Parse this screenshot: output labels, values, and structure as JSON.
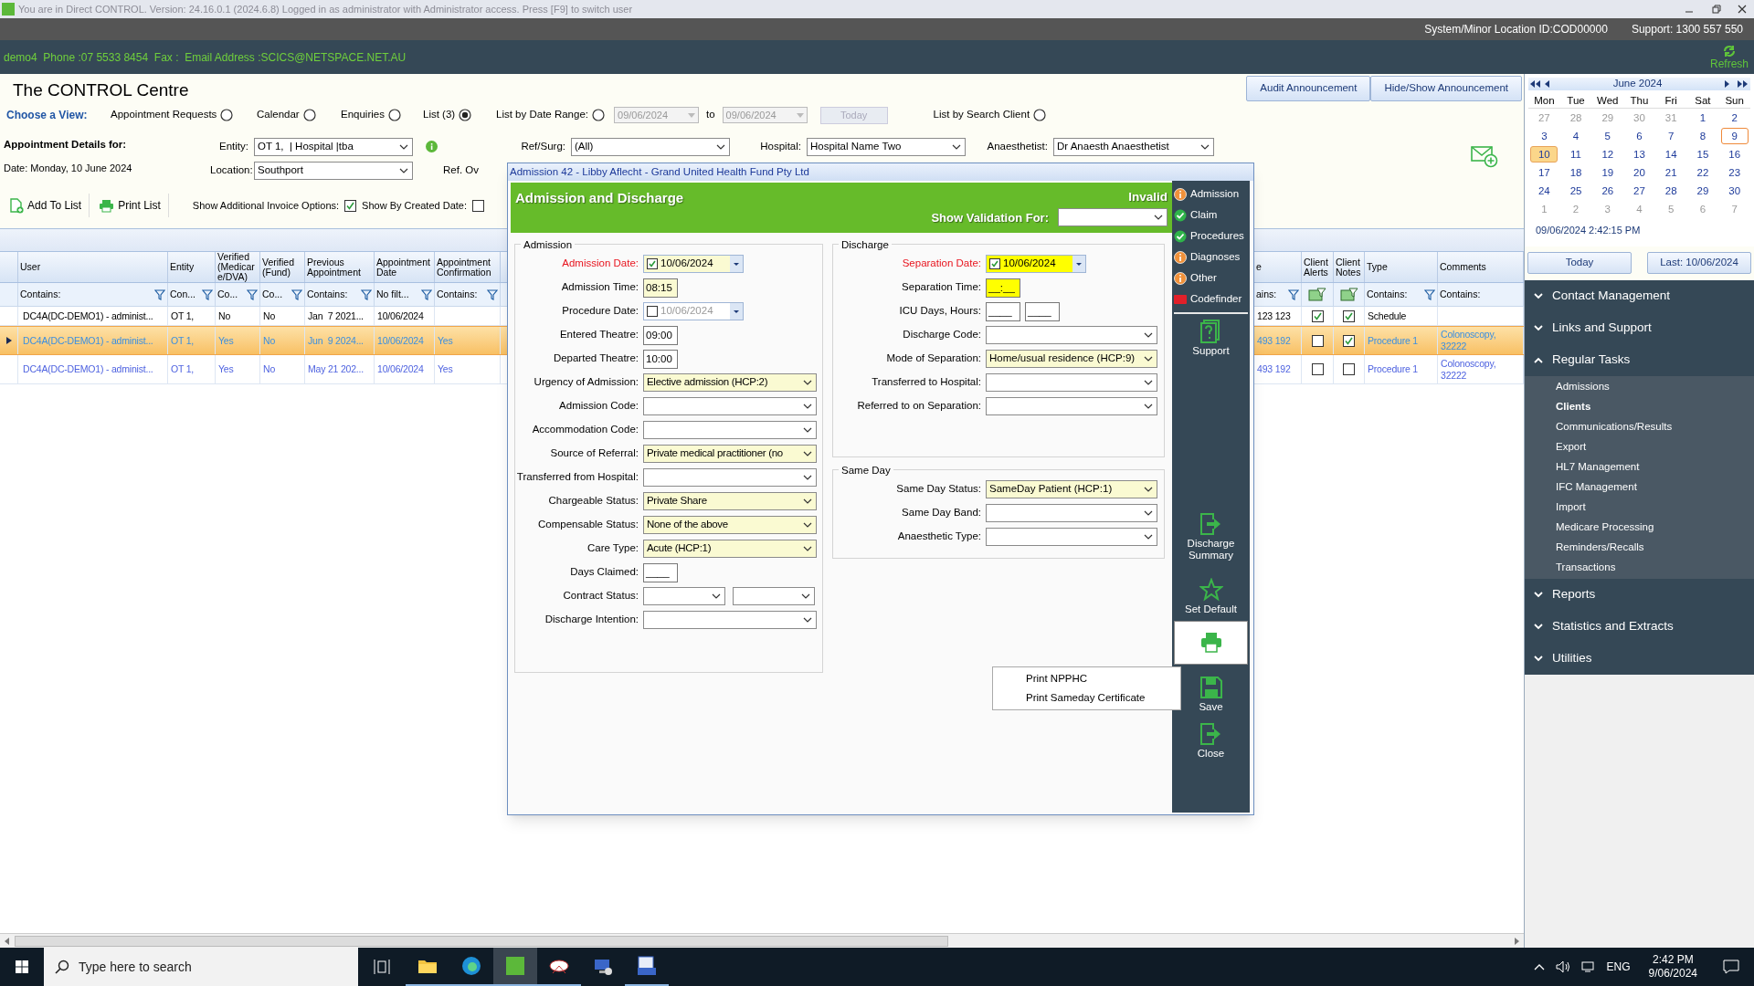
{
  "title_bar": {
    "text": "You are in Direct CONTROL. Version: 24.16.0.1 (2024.6.8) Logged in as administrator with Administrator access. Press [F9] to switch user"
  },
  "info_bar": {
    "location": "System/Minor Location ID:COD00000",
    "support": "Support: 1300 557 550"
  },
  "contact_bar": {
    "contact": "demo4  Phone :07 5533 8454  Fax :  Email Address :SCICS@NETSPACE.NET.AU",
    "refresh": "Refresh"
  },
  "page_title": "The CONTROL Centre",
  "announcement_buttons": [
    "Audit Announcement",
    "Hide/Show Announcement"
  ],
  "view_label": "Choose a View:",
  "views": [
    {
      "label": "Appointment Requests",
      "selected": false,
      "kind": "plain"
    },
    {
      "label": "Calendar",
      "selected": false,
      "kind": "plain"
    },
    {
      "label": "Enquiries",
      "selected": false,
      "kind": "plain"
    },
    {
      "label": "List (3)",
      "selected": true,
      "kind": "plain"
    },
    {
      "label": "List by Date Range:",
      "selected": false,
      "kind": "range",
      "from": "09/06/2024",
      "to_label": "to",
      "to": "09/06/2024",
      "button": "Today"
    },
    {
      "label": "List by Search Client",
      "selected": false,
      "kind": "plain"
    }
  ],
  "details": {
    "heading": "Appointment Details for:",
    "date": "Date: Monday, 10 June 2024"
  },
  "filter_rows": [
    [
      {
        "label": "Entity:",
        "value": "OT 1,  | Hospital |tba"
      },
      {
        "label": "Ref/Surg:",
        "value": "(All)"
      },
      {
        "label": "Hospital:",
        "value": "Hospital Name Two"
      },
      {
        "label": "Anaesthetist:",
        "value": "Dr Anaesth Anaesthetist"
      }
    ],
    [
      {
        "label": "Location:",
        "value": "Southport"
      },
      {
        "label": "Ref. Ov"
      }
    ]
  ],
  "toolbar": [
    {
      "label": "Add To List",
      "kind": "add"
    },
    {
      "label": "Print List",
      "kind": "print"
    }
  ],
  "options": [
    {
      "label": "Show Additional Invoice Options:",
      "checked": true
    },
    {
      "label": "Show By Created Date:",
      "checked": false
    }
  ],
  "table": {
    "columns": [
      {
        "label": "User",
        "filter": "Contains:",
        "funnel": true
      },
      {
        "label": "Entity",
        "filter": "Con...",
        "funnel": true
      },
      {
        "label": "Verified (Medicare/DVA)",
        "filter": "Co...",
        "funnel": true
      },
      {
        "label": "Verified (Fund)",
        "filter": "Co...",
        "funnel": true
      },
      {
        "label": "Previous Appointment",
        "filter": "Contains:",
        "funnel": true
      },
      {
        "label": "Appointment Date",
        "filter": "No filt...",
        "funnel": true
      },
      {
        "label": "Appointment Confirmation",
        "filter": "Contains:",
        "funnel": true
      },
      {
        "label": "e",
        "filter": "ains:",
        "funnel": true
      },
      {
        "label": "Client Alerts",
        "funnel": false
      },
      {
        "label": "Client Notes",
        "funnel": false
      },
      {
        "label": "Type",
        "filter": "Contains:",
        "funnel": true
      },
      {
        "label": "Comments",
        "filter": "Contains:",
        "funnel": false
      }
    ],
    "rows": [
      {
        "selected": false,
        "color": "#000000",
        "cells": [
          "DC4A(DC-DEMO1) - administ...",
          "OT 1,",
          "No",
          "No",
          "Jan  7 2021...",
          "10/06/2024",
          null,
          "123 123",
          {
            "checked": true
          },
          {
            "checked": true
          },
          "Schedule",
          null
        ]
      },
      {
        "selected": true,
        "color": "#3b8fe0",
        "cells": [
          "DC4A(DC-DEMO1) - administ...",
          "OT 1,",
          "Yes",
          "No",
          "Jun  9 2024...",
          "10/06/2024",
          "Yes",
          "493 192",
          {
            "checked": false
          },
          {
            "checked": true
          },
          "Procedure 1",
          "Colonoscopy, 32222"
        ]
      },
      {
        "selected": false,
        "color": "#4f63e0",
        "cells": [
          "DC4A(DC-DEMO1) - administ...",
          "OT 1,",
          "Yes",
          "No",
          "May 21 202...",
          "10/06/2024",
          "Yes",
          "493 192",
          {
            "checked": false
          },
          {
            "checked": false
          },
          "Procedure 1",
          "Colonoscopy, 32222"
        ]
      }
    ]
  },
  "dialog": {
    "title": "Admission 42 - Libby Aflecht - Grand United Health Fund Pty Ltd",
    "heading": "Admission and Discharge",
    "status": "Invalid",
    "validation_label": "Show Validation For:",
    "groups": [
      {
        "title": "Admission",
        "fields": [
          {
            "label": "Admission Date:",
            "kind": "date",
            "checked": true,
            "value": "10/06/2024",
            "required": true,
            "highlighted": true,
            "missing": false
          },
          {
            "label": "Admission Time:",
            "kind": "time",
            "value": "08:15",
            "required": false,
            "highlighted": true,
            "missing": false
          },
          {
            "label": "Procedure Date:",
            "kind": "date",
            "checked": false,
            "value": "10/06/2024",
            "required": false,
            "highlighted": false,
            "missing": false
          },
          {
            "label": "Entered Theatre:",
            "kind": "time",
            "value": "09:00",
            "required": false,
            "highlighted": false,
            "missing": false
          },
          {
            "label": "Departed Theatre:",
            "kind": "time",
            "value": "10:00",
            "required": false,
            "highlighted": false,
            "missing": false
          },
          {
            "label": "Urgency of Admission:",
            "kind": "select",
            "value": "Elective admission (HCP:2)",
            "required": false,
            "highlighted": true,
            "missing": false
          },
          {
            "label": "Admission Code:",
            "kind": "select",
            "required": false,
            "highlighted": false,
            "missing": false
          },
          {
            "label": "Accommodation Code:",
            "kind": "select",
            "required": false,
            "highlighted": false,
            "missing": false
          },
          {
            "label": "Source of Referral:",
            "kind": "select",
            "value": "Private medical practitioner (no",
            "required": false,
            "highlighted": true,
            "missing": false
          },
          {
            "label": "Transferred from Hospital:",
            "kind": "select",
            "required": false,
            "highlighted": false,
            "missing": false
          },
          {
            "label": "Chargeable Status:",
            "kind": "select",
            "value": "Private Share",
            "required": false,
            "highlighted": true,
            "missing": false
          },
          {
            "label": "Compensable Status:",
            "kind": "select",
            "value": "None of the above",
            "required": false,
            "highlighted": true,
            "missing": false
          },
          {
            "label": "Care Type:",
            "kind": "select",
            "value": "Acute (HCP:1)",
            "required": false,
            "highlighted": true,
            "missing": false
          },
          {
            "label": "Days Claimed:",
            "kind": "time",
            "value": "____",
            "required": false,
            "highlighted": false,
            "missing": false
          },
          {
            "label": "Contract Status:",
            "kind": "select_pair",
            "required": false,
            "highlighted": false,
            "missing": false
          },
          {
            "label": "Discharge Intention:",
            "kind": "select",
            "required": false,
            "highlighted": false,
            "missing": false
          }
        ]
      },
      {
        "title": "Discharge",
        "fields": [
          {
            "label": "Separation Date:",
            "kind": "date",
            "checked": true,
            "value": "10/06/2024",
            "required": true,
            "missing": true
          },
          {
            "label": "Separation Time:",
            "kind": "time",
            "value": "__:__",
            "required": false,
            "missing": true
          },
          {
            "label": "ICU Days, Hours:",
            "kind": "time_pair",
            "values": [
              "____",
              "____"
            ],
            "required": false,
            "highlighted": false,
            "missing": false
          },
          {
            "label": "Discharge Code:",
            "kind": "select",
            "required": false,
            "highlighted": false,
            "missing": false
          },
          {
            "label": "Mode of Separation:",
            "kind": "select",
            "value": "Home/usual residence (HCP:9)",
            "required": false,
            "highlighted": true,
            "missing": false
          },
          {
            "label": "Transferred to Hospital:",
            "kind": "select",
            "required": false,
            "highlighted": false,
            "missing": false
          },
          {
            "label": "Referred to on Separation:",
            "kind": "select",
            "required": false,
            "highlighted": false,
            "missing": false
          }
        ]
      },
      {
        "title": "Same Day",
        "fields": [
          {
            "label": "Same Day Status:",
            "kind": "select",
            "value": "SameDay Patient (HCP:1)",
            "required": false,
            "highlighted": true,
            "missing": false
          },
          {
            "label": "Same Day Band:",
            "kind": "select",
            "required": false,
            "highlighted": false,
            "missing": false
          },
          {
            "label": "Anaesthetic Type:",
            "kind": "select",
            "required": false,
            "highlighted": false,
            "missing": false
          }
        ]
      }
    ],
    "validation": [
      {
        "label": "Admission",
        "kind": "warning"
      },
      {
        "label": "Claim",
        "kind": "ok"
      },
      {
        "label": "Procedures",
        "kind": "ok"
      },
      {
        "label": "Diagnoses",
        "kind": "warning"
      },
      {
        "label": "Other",
        "kind": "warning"
      },
      {
        "label": "Codefinder",
        "kind": "logo"
      }
    ],
    "actions": [
      {
        "label": "Support",
        "kind": "help"
      },
      {
        "label": "Discharge Summary",
        "kind": "export"
      },
      {
        "label": "Set Default",
        "kind": "star"
      },
      {
        "kind": "print"
      },
      {
        "label": "Save",
        "kind": "save"
      },
      {
        "label": "Close",
        "kind": "close"
      }
    ],
    "print_menu": [
      "Print NPPHC",
      "Print Sameday Certificate"
    ]
  },
  "calendar": {
    "title": "June 2024",
    "weekdays": [
      "Mon",
      "Tue",
      "Wed",
      "Thu",
      "Fri",
      "Sat",
      "Sun"
    ],
    "days": [
      {
        "day": "27",
        "outside": true,
        "selected": false,
        "today": false
      },
      {
        "day": "28",
        "outside": true,
        "selected": false,
        "today": false
      },
      {
        "day": "29",
        "outside": true,
        "selected": false,
        "today": false
      },
      {
        "day": "30",
        "outside": true,
        "selected": false,
        "today": false
      },
      {
        "day": "31",
        "outside": true,
        "selected": false,
        "today": false
      },
      {
        "day": "1",
        "outside": false,
        "selected": false,
        "today": false
      },
      {
        "day": "2",
        "outside": false,
        "selected": false,
        "today": false
      },
      {
        "day": "3",
        "outside": false,
        "selected": false,
        "today": false
      },
      {
        "day": "4",
        "outside": false,
        "selected": false,
        "today": false
      },
      {
        "day": "5",
        "outside": false,
        "selected": false,
        "today": false
      },
      {
        "day": "6",
        "outside": false,
        "selected": false,
        "today": false
      },
      {
        "day": "7",
        "outside": false,
        "selected": false,
        "today": false
      },
      {
        "day": "8",
        "outside": false,
        "selected": false,
        "today": false
      },
      {
        "day": "9",
        "outside": false,
        "selected": false,
        "today": true
      },
      {
        "day": "10",
        "outside": false,
        "selected": true,
        "today": false
      },
      {
        "day": "11",
        "outside": false,
        "selected": false,
        "today": false
      },
      {
        "day": "12",
        "outside": false,
        "selected": false,
        "today": false
      },
      {
        "day": "13",
        "outside": false,
        "selected": false,
        "today": false
      },
      {
        "day": "14",
        "outside": false,
        "selected": false,
        "today": false
      },
      {
        "day": "15",
        "outside": false,
        "selected": false,
        "today": false
      },
      {
        "day": "16",
        "outside": false,
        "selected": false,
        "today": false
      },
      {
        "day": "17",
        "outside": false,
        "selected": false,
        "today": false
      },
      {
        "day": "18",
        "outside": false,
        "selected": false,
        "today": false
      },
      {
        "day": "19",
        "outside": false,
        "selected": false,
        "today": false
      },
      {
        "day": "20",
        "outside": false,
        "selected": false,
        "today": false
      },
      {
        "day": "21",
        "outside": false,
        "selected": false,
        "today": false
      },
      {
        "day": "22",
        "outside": false,
        "selected": false,
        "today": false
      },
      {
        "day": "23",
        "outside": false,
        "selected": false,
        "today": false
      },
      {
        "day": "24",
        "outside": false,
        "selected": false,
        "today": false
      },
      {
        "day": "25",
        "outside": false,
        "selected": false,
        "today": false
      },
      {
        "day": "26",
        "outside": false,
        "selected": false,
        "today": false
      },
      {
        "day": "27",
        "outside": false,
        "selected": false,
        "today": false
      },
      {
        "day": "28",
        "outside": false,
        "selected": false,
        "today": false
      },
      {
        "day": "29",
        "outside": false,
        "selected": false,
        "today": false
      },
      {
        "day": "30",
        "outside": false,
        "selected": false,
        "today": false
      },
      {
        "day": "1",
        "outside": true,
        "selected": false,
        "today": false
      },
      {
        "day": "2",
        "outside": true,
        "selected": false,
        "today": false
      },
      {
        "day": "3",
        "outside": true,
        "selected": false,
        "today": false
      },
      {
        "day": "4",
        "outside": true,
        "selected": false,
        "today": false
      },
      {
        "day": "5",
        "outside": true,
        "selected": false,
        "today": false
      },
      {
        "day": "6",
        "outside": true,
        "selected": false,
        "today": false
      },
      {
        "day": "7",
        "outside": true,
        "selected": false,
        "today": false
      }
    ],
    "footer": "09/06/2024 2:42:15 PM"
  },
  "calendar_buttons": [
    "Today",
    "Last: 10/06/2024"
  ],
  "nav": [
    {
      "label": "Contact Management",
      "expanded": false
    },
    {
      "label": "Links and Support",
      "expanded": false
    },
    {
      "label": "Regular Tasks",
      "expanded": true,
      "children": [
        {
          "label": "Admissions",
          "selected": false
        },
        {
          "label": "Clients",
          "selected": true
        },
        {
          "label": "Communications/Results",
          "selected": false
        },
        {
          "label": "Export",
          "selected": false
        },
        {
          "label": "HL7 Management",
          "selected": false
        },
        {
          "label": "IFC Management",
          "selected": false
        },
        {
          "label": "Import",
          "selected": false
        },
        {
          "label": "Medicare Processing",
          "selected": false
        },
        {
          "label": "Reminders/Recalls",
          "selected": false
        },
        {
          "label": "Transactions",
          "selected": false
        }
      ]
    },
    {
      "label": "Reports",
      "expanded": false
    },
    {
      "label": "Statistics and Extracts",
      "expanded": false
    },
    {
      "label": "Utilities",
      "expanded": false
    }
  ],
  "taskbar": {
    "search_placeholder": "Type here to search",
    "language": "ENG",
    "time": "2:42 PM",
    "date": "9/06/2024"
  }
}
